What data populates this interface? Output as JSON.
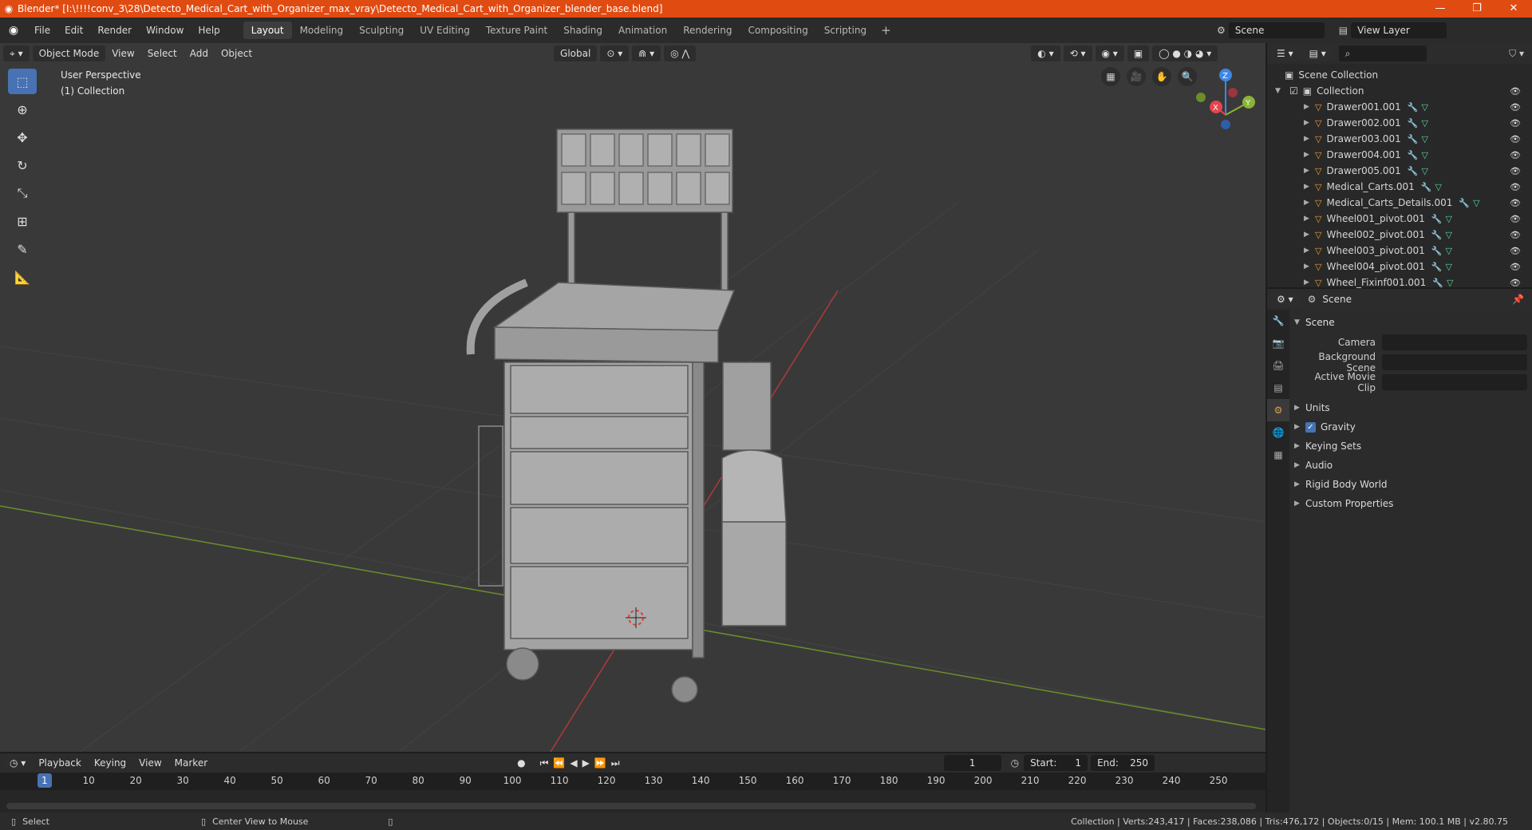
{
  "window": {
    "title": "Blender* [I:\\!!!!conv_3\\28\\Detecto_Medical_Cart_with_Organizer_max_vray\\Detecto_Medical_Cart_with_Organizer_blender_base.blend]",
    "minimize": "—",
    "maximize": "❐",
    "close": "✕"
  },
  "menu": [
    "File",
    "Edit",
    "Render",
    "Window",
    "Help"
  ],
  "workspaces": [
    "Layout",
    "Modeling",
    "Sculpting",
    "UV Editing",
    "Texture Paint",
    "Shading",
    "Animation",
    "Rendering",
    "Compositing",
    "Scripting"
  ],
  "active_workspace": "Layout",
  "scene_name": "Scene",
  "view_layer": "View Layer",
  "viewport": {
    "mode": "Object Mode",
    "menus": [
      "View",
      "Select",
      "Add",
      "Object"
    ],
    "transform_orientation": "Global",
    "perspective": "User Perspective",
    "collection": "(1) Collection"
  },
  "outliner": {
    "root": "Scene Collection",
    "collection": "Collection",
    "objects": [
      "Drawer001.001",
      "Drawer002.001",
      "Drawer003.001",
      "Drawer004.001",
      "Drawer005.001",
      "Medical_Carts.001",
      "Medical_Carts_Details.001",
      "Wheel001_pivot.001",
      "Wheel002_pivot.001",
      "Wheel003_pivot.001",
      "Wheel004_pivot.001",
      "Wheel_Fixinf001.001"
    ]
  },
  "properties": {
    "context": "Scene",
    "panel": "Scene",
    "fields": [
      {
        "label": "Camera"
      },
      {
        "label": "Background Scene"
      },
      {
        "label": "Active Movie Clip"
      }
    ],
    "subpanels": [
      "Units",
      "Gravity",
      "Keying Sets",
      "Audio",
      "Rigid Body World",
      "Custom Properties"
    ],
    "gravity_checked": true
  },
  "timeline": {
    "menus": [
      "Playback",
      "Keying",
      "View",
      "Marker"
    ],
    "current_frame": "1",
    "start_label": "Start:",
    "start": "1",
    "end_label": "End:",
    "end": "250",
    "ruler": [
      "1",
      "10",
      "20",
      "30",
      "40",
      "50",
      "60",
      "70",
      "80",
      "90",
      "100",
      "110",
      "120",
      "130",
      "140",
      "150",
      "160",
      "170",
      "180",
      "190",
      "200",
      "210",
      "220",
      "230",
      "240",
      "250"
    ]
  },
  "status": {
    "left_action": "Select",
    "middle_action": "Center View to Mouse",
    "stats": "Collection | Verts:243,417 | Faces:238,086 | Tris:476,172 | Objects:0/15 | Mem: 100.1 MB | v2.80.75"
  },
  "colors": {
    "title_bar": "#e04b12",
    "accent": "#4772b3",
    "x_axis": "#e8434e",
    "y_axis": "#8ab438",
    "z_axis": "#3f86e5"
  }
}
